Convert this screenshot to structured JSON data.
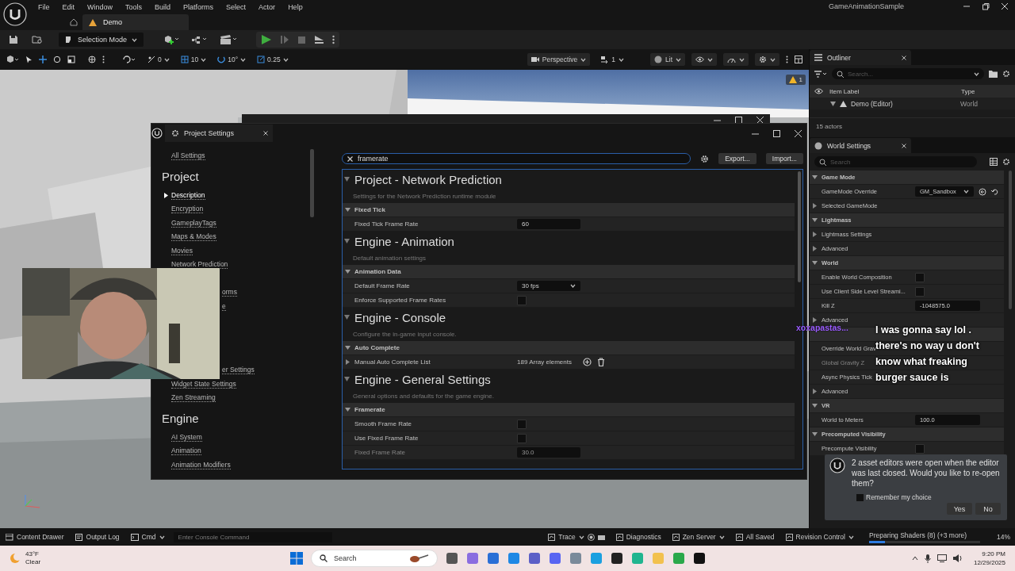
{
  "menu_bar": {
    "menus": [
      "File",
      "Edit",
      "Window",
      "Tools",
      "Build",
      "Platforms",
      "Select",
      "Actor",
      "Help"
    ],
    "project_name": "GameAnimationSample"
  },
  "level_tabs": [
    {
      "label": "Demo",
      "selected": true
    }
  ],
  "toolbar": {
    "mode": "Selection Mode"
  },
  "viewport": {
    "snap_values": [
      "0",
      "10",
      "10°",
      "0.25"
    ],
    "view_mode": "Perspective",
    "camera_speed": "1",
    "lighting": "Lit",
    "warning_count": "1"
  },
  "outliner": {
    "tab": "Outliner",
    "search_placeholder": "Search...",
    "columns": [
      "Item Label",
      "Type"
    ],
    "rows": [
      {
        "label": "Demo (Editor)",
        "type": "World",
        "expanded": true
      }
    ],
    "actor_count": "15 actors"
  },
  "world_settings": {
    "tab": "World Settings",
    "search_placeholder": "Search",
    "rows": [
      {
        "kind": "category",
        "label": "Game Mode",
        "expanded": true
      },
      {
        "kind": "dropdown",
        "label": "GameMode Override",
        "value": "GM_Sandbox"
      },
      {
        "kind": "group",
        "label": "Selected GameMode",
        "expanded": false
      },
      {
        "kind": "category",
        "label": "Lightmass",
        "expanded": true
      },
      {
        "kind": "group",
        "label": "Lightmass Settings",
        "expanded": false
      },
      {
        "kind": "group",
        "label": "Advanced",
        "expanded": false
      },
      {
        "kind": "category",
        "label": "World",
        "expanded": true
      },
      {
        "kind": "checkbox",
        "label": "Enable World Composition",
        "checked": false
      },
      {
        "kind": "checkbox",
        "label": "Use Client Side Level Streami...",
        "checked": false
      },
      {
        "kind": "number",
        "label": "Kill Z",
        "value": "-1048575.0"
      },
      {
        "kind": "group",
        "label": "Advanced",
        "expanded": false
      },
      {
        "kind": "category"
      },
      {
        "kind": "label",
        "label": "Override World Grav",
        "disabled": false
      },
      {
        "kind": "label",
        "label": "Global Gravity Z",
        "disabled": true
      },
      {
        "kind": "label",
        "label": "Async Physics Tick",
        "disabled": false
      },
      {
        "kind": "group",
        "label": "Advanced",
        "expanded": false
      },
      {
        "kind": "category",
        "label": "VR",
        "expanded": true
      },
      {
        "kind": "number",
        "label": "World to Meters",
        "value": "100.0"
      },
      {
        "kind": "category",
        "label": "Precomputed Visibility",
        "expanded": true
      },
      {
        "kind": "checkbox",
        "label": "Precompute Visibility",
        "checked": false
      }
    ]
  },
  "project_settings": {
    "title": "Project Settings",
    "all_settings": "All Settings",
    "nav": [
      {
        "heading": "Project",
        "items": [
          {
            "kind": "link",
            "label": "Description",
            "selected": true
          },
          {
            "kind": "link",
            "label": "Encryption",
            "selected": false
          },
          {
            "kind": "link",
            "label": "GameplayTags",
            "selected": false
          },
          {
            "kind": "link",
            "label": "Maps & Modes",
            "selected": false
          },
          {
            "kind": "link",
            "label": "Movies",
            "selected": false
          },
          {
            "kind": "link",
            "label": "Network Prediction",
            "selected": false
          },
          {
            "kind": "fragment",
            "label": "orms",
            "selected": false
          },
          {
            "kind": "fragment",
            "label": "e",
            "selected": false
          },
          {
            "kind": "fragment",
            "label": "er Settings",
            "selected": false
          },
          {
            "kind": "link",
            "label": "Widget State Settings",
            "selected": false
          },
          {
            "kind": "link",
            "label": "Zen Streaming",
            "selected": false
          }
        ]
      },
      {
        "heading": "Engine",
        "items": [
          {
            "kind": "link",
            "label": "AI System",
            "selected": false
          },
          {
            "kind": "link",
            "label": "Animation",
            "selected": false
          },
          {
            "kind": "link",
            "label": "Animation Modifiers",
            "selected": false
          }
        ]
      }
    ],
    "search_value": "framerate",
    "buttons": [
      "Export...",
      "Import..."
    ],
    "sections": [
      {
        "title": "Project - Network Prediction",
        "description": "Settings for the Network Prediction runtime module",
        "rows": [
          {
            "kind": "category",
            "label": "Fixed Tick",
            "expanded": true
          },
          {
            "kind": "number",
            "label": "Fixed Tick Frame Rate",
            "value": "60",
            "disabled": false
          }
        ]
      },
      {
        "title": "Engine - Animation",
        "description": "Default animation settings",
        "rows": [
          {
            "kind": "category",
            "label": "Animation Data",
            "expanded": true
          },
          {
            "kind": "dropdown",
            "label": "Default Frame Rate",
            "value": "30 fps"
          },
          {
            "kind": "checkbox",
            "label": "Enforce Supported Frame Rates",
            "checked": false
          }
        ]
      },
      {
        "title": "Engine - Console",
        "description": "Configure the in-game input console.",
        "rows": [
          {
            "kind": "category",
            "label": "Auto Complete",
            "expanded": true
          },
          {
            "kind": "array",
            "label": "Manual Auto Complete List",
            "value": "189 Array elements",
            "expanded": false
          }
        ]
      },
      {
        "title": "Engine - General Settings",
        "description": "General options and defaults for the game engine.",
        "rows": [
          {
            "kind": "category",
            "label": "Framerate",
            "expanded": true
          },
          {
            "kind": "checkbox",
            "label": "Smooth Frame Rate",
            "checked": false
          },
          {
            "kind": "checkbox",
            "label": "Use Fixed Frame Rate",
            "checked": false
          },
          {
            "kind": "number",
            "label": "Fixed Frame Rate",
            "value": "30.0",
            "disabled": true
          }
        ]
      }
    ]
  },
  "chat": {
    "user": "xoxapastas...",
    "message": "I was gonna say lol . there's no way u don't know what freaking burger sauce is"
  },
  "toast": {
    "message": "2 asset editors were open when the editor was last closed. Would you like to re-open them?",
    "remember": {
      "label": "Remember my choice",
      "checked": false
    },
    "buttons": [
      "Yes",
      "No"
    ]
  },
  "status_bar": {
    "left": [
      "Content Drawer",
      "Output Log",
      "Cmd"
    ],
    "console_placeholder": "Enter Console Command",
    "right": [
      "Trace",
      "Diagnostics",
      "Zen Server",
      "All Saved",
      "Revision Control"
    ],
    "task": {
      "label": "Preparing Shaders (8) (+3 more)",
      "level": 0.14,
      "percent": "14%"
    }
  },
  "taskbar": {
    "weather": {
      "temp": "43°F",
      "condition": "Clear"
    },
    "search_placeholder": "Search",
    "time": "9:20 PM",
    "date": "12/29/2025"
  }
}
